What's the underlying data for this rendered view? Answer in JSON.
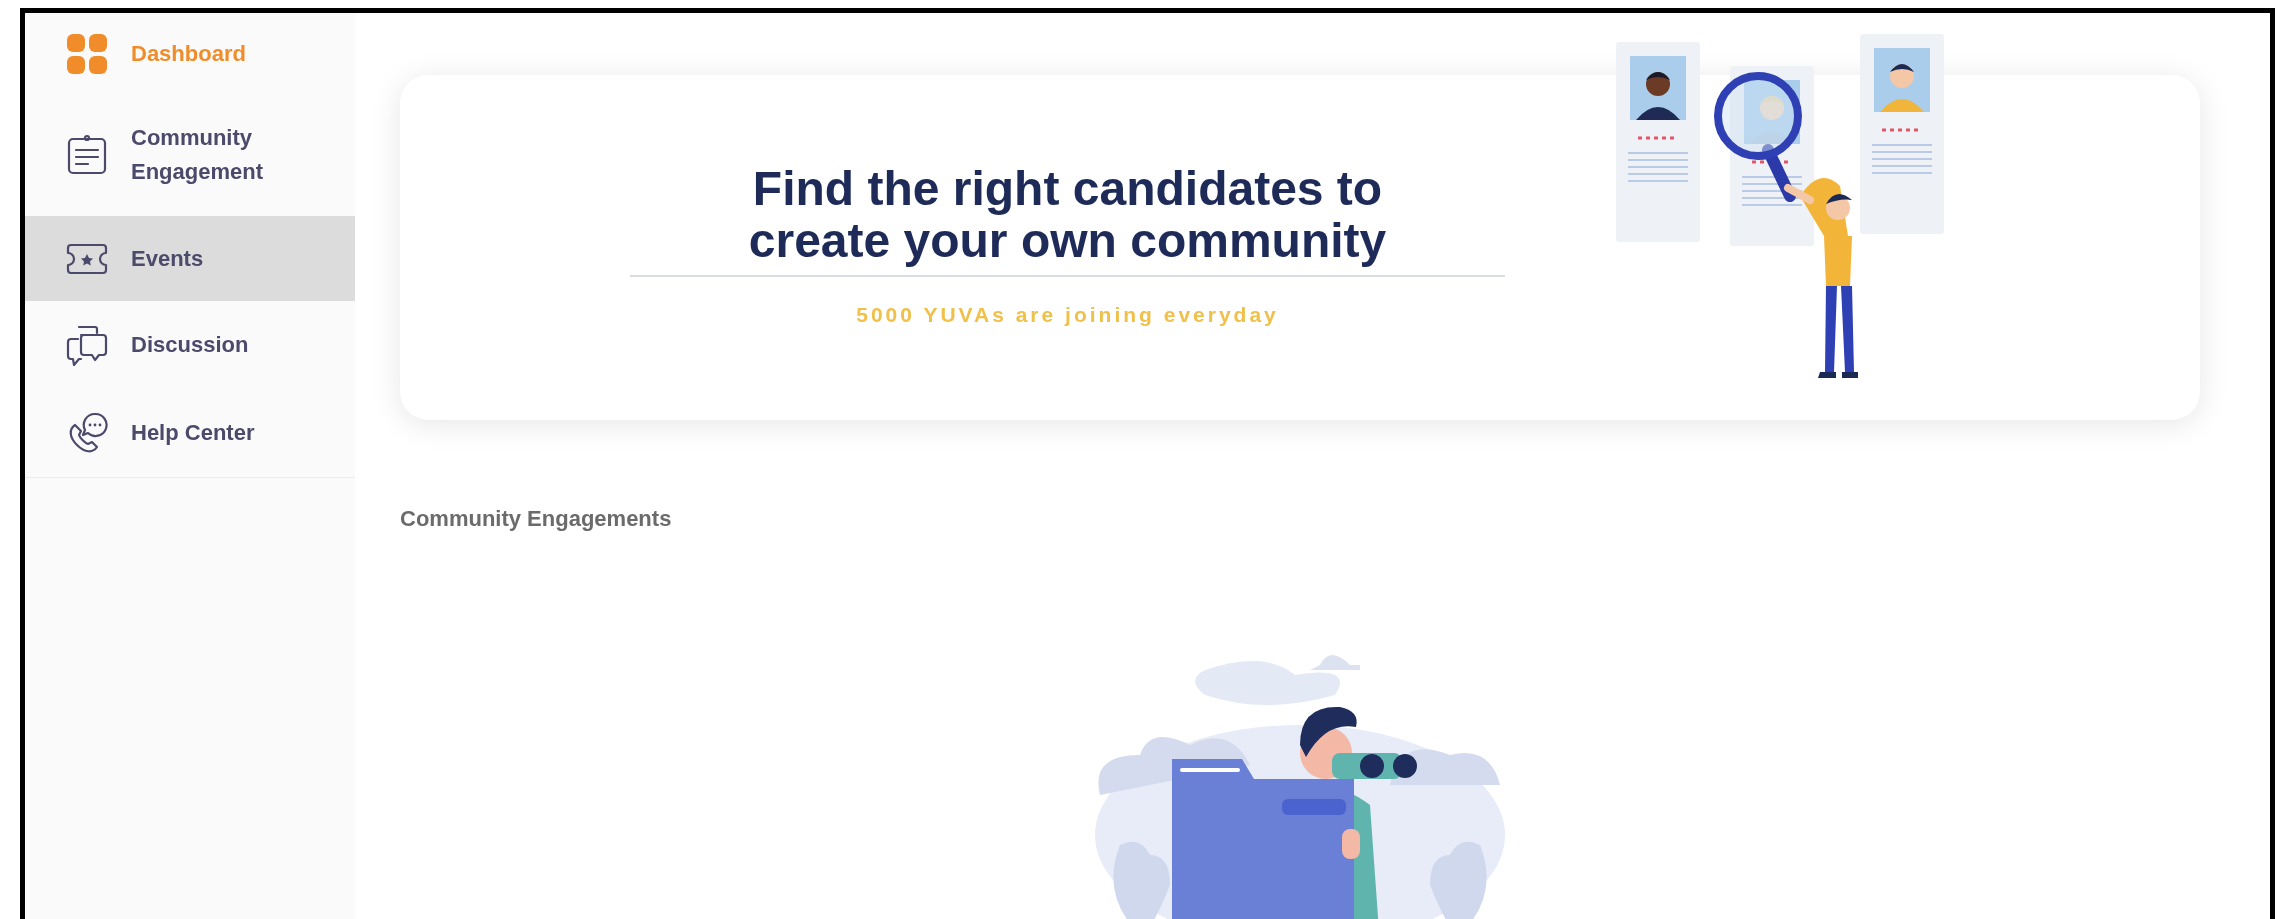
{
  "sidebar": {
    "items": [
      {
        "label": "Dashboard",
        "selected": true,
        "hovered": false
      },
      {
        "label": "Community Engagement",
        "selected": false,
        "hovered": false
      },
      {
        "label": "Events",
        "selected": false,
        "hovered": true
      },
      {
        "label": "Discussion",
        "selected": false,
        "hovered": false
      },
      {
        "label": "Help Center",
        "selected": false,
        "hovered": false
      }
    ]
  },
  "banner": {
    "title_lines": [
      "Find the right candidates to",
      "create your own community"
    ],
    "subtitle": "5000 YUVAs are joining everyday"
  },
  "section": {
    "title": "Community Engagements"
  }
}
